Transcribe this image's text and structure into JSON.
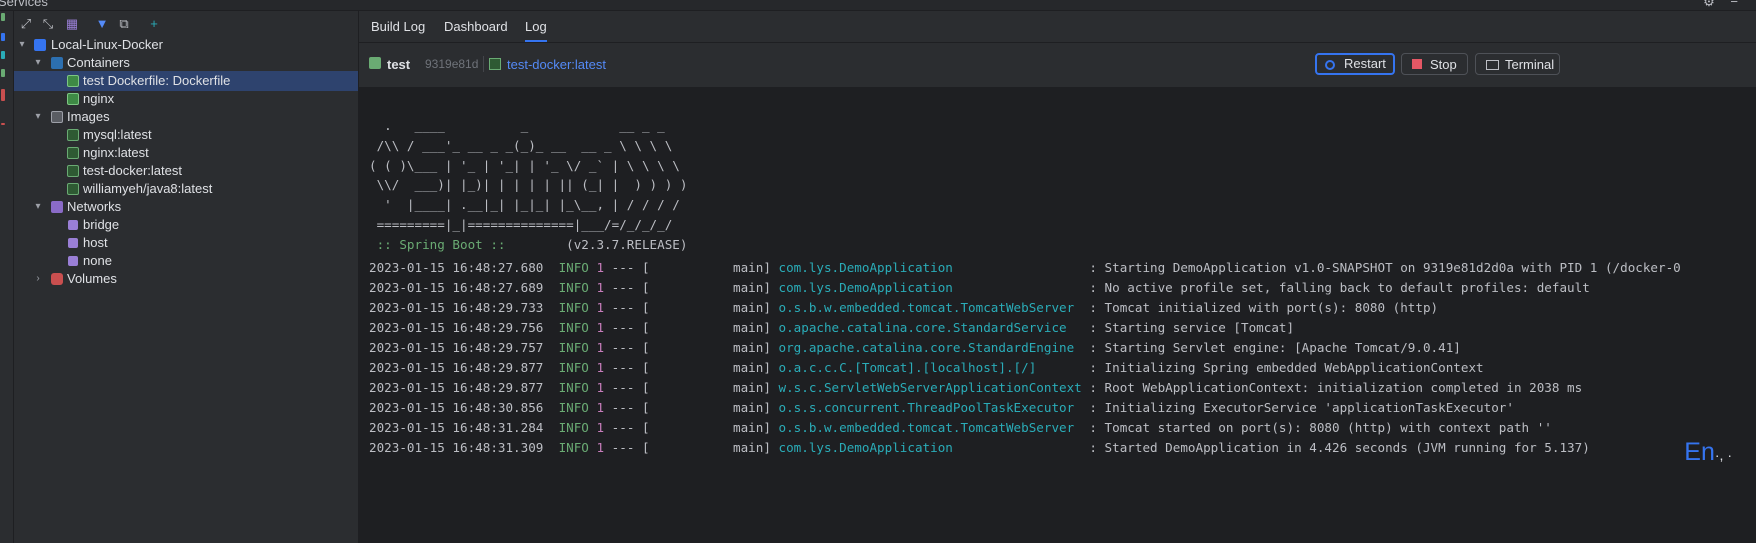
{
  "window": {
    "title": "Services"
  },
  "tree": {
    "nodes": [
      {
        "label": "Local-Linux-Docker"
      },
      {
        "label": "Containers"
      },
      {
        "label": "test Dockerfile: Dockerfile"
      },
      {
        "label": "nginx"
      },
      {
        "label": "Images"
      },
      {
        "label": "mysql:latest"
      },
      {
        "label": "nginx:latest"
      },
      {
        "label": "test-docker:latest"
      },
      {
        "label": "williamyeh/java8:latest"
      },
      {
        "label": "Networks"
      },
      {
        "label": "bridge"
      },
      {
        "label": "host"
      },
      {
        "label": "none"
      },
      {
        "label": "Volumes"
      }
    ]
  },
  "tabs": [
    {
      "label": "Build Log"
    },
    {
      "label": "Dashboard"
    },
    {
      "label": "Log"
    }
  ],
  "container": {
    "name": "test",
    "id": "9319e81d",
    "image": "test-docker:latest"
  },
  "buttons": {
    "restart": "Restart",
    "stop": "Stop",
    "terminal": "Terminal"
  },
  "banner": {
    "l1": "  .   ____          _            __ _ _",
    "l2": " /\\\\ / ___'_ __ _ _(_)_ __  __ _ \\ \\ \\ \\",
    "l3": "( ( )\\___ | '_ | '_| | '_ \\/ _` | \\ \\ \\ \\",
    "l4": " \\\\/  ___)| |_)| | | | | || (_| |  ) ) ) )",
    "l5": "  '  |____| .__|_| |_|_| |_\\__, | / / / /",
    "l6": " =========|_|==============|___/=/_/_/_/",
    "spring": " :: Spring Boot :: ",
    "version": "       (v2.3.7.RELEASE)"
  },
  "log": [
    {
      "date": "2023-01-15 16:48:27.680",
      "level": "INFO",
      "pid": "1",
      "sep": " --- [           main] ",
      "logger": "com.lys.DemoApplication                 ",
      "msg": " : Starting DemoApplication v1.0-SNAPSHOT on 9319e81d2d0a with PID 1 (/docker-0"
    },
    {
      "date": "2023-01-15 16:48:27.689",
      "level": "INFO",
      "pid": "1",
      "sep": " --- [           main] ",
      "logger": "com.lys.DemoApplication                 ",
      "msg": " : No active profile set, falling back to default profiles: default"
    },
    {
      "date": "2023-01-15 16:48:29.733",
      "level": "INFO",
      "pid": "1",
      "sep": " --- [           main] ",
      "logger": "o.s.b.w.embedded.tomcat.TomcatWebServer ",
      "msg": " : Tomcat initialized with port(s): 8080 (http)"
    },
    {
      "date": "2023-01-15 16:48:29.756",
      "level": "INFO",
      "pid": "1",
      "sep": " --- [           main] ",
      "logger": "o.apache.catalina.core.StandardService  ",
      "msg": " : Starting service [Tomcat]"
    },
    {
      "date": "2023-01-15 16:48:29.757",
      "level": "INFO",
      "pid": "1",
      "sep": " --- [           main] ",
      "logger": "org.apache.catalina.core.StandardEngine ",
      "msg": " : Starting Servlet engine: [Apache Tomcat/9.0.41]"
    },
    {
      "date": "2023-01-15 16:48:29.877",
      "level": "INFO",
      "pid": "1",
      "sep": " --- [           main] ",
      "logger": "o.a.c.c.C.[Tomcat].[localhost].[/]      ",
      "msg": " : Initializing Spring embedded WebApplicationContext"
    },
    {
      "date": "2023-01-15 16:48:29.877",
      "level": "INFO",
      "pid": "1",
      "sep": " --- [           main] ",
      "logger": "w.s.c.ServletWebServerApplicationContext",
      "msg": " : Root WebApplicationContext: initialization completed in 2038 ms"
    },
    {
      "date": "2023-01-15 16:48:30.856",
      "level": "INFO",
      "pid": "1",
      "sep": " --- [           main] ",
      "logger": "o.s.s.concurrent.ThreadPoolTaskExecutor ",
      "msg": " : Initializing ExecutorService 'applicationTaskExecutor'"
    },
    {
      "date": "2023-01-15 16:48:31.284",
      "level": "INFO",
      "pid": "1",
      "sep": " --- [           main] ",
      "logger": "o.s.b.w.embedded.tomcat.TomcatWebServer ",
      "msg": " : Tomcat started on port(s): 8080 (http) with context path ''"
    },
    {
      "date": "2023-01-15 16:48:31.309",
      "level": "INFO",
      "pid": "1",
      "sep": " --- [           main] ",
      "logger": "com.lys.DemoApplication                 ",
      "msg": " : Started DemoApplication in 4.426 seconds (JVM running for 5.137)"
    }
  ],
  "ime": {
    "lang": "En",
    "mark": "·, ·"
  }
}
